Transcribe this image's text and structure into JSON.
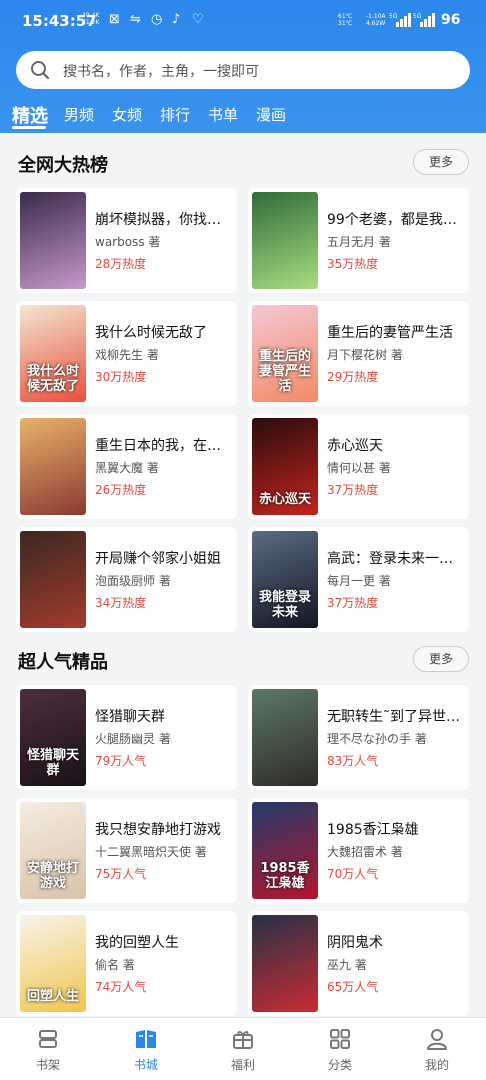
{
  "status_bar": {
    "time": "15:43:57",
    "net_speed_top": "49.4K",
    "net_speed_bottom": "61.2K",
    "temp_top": "61℃",
    "temp_bottom": "31℃",
    "speed_top": "-1.10A",
    "speed_bottom": "4.62W",
    "sim1": "5G",
    "sim2": "5G",
    "battery": "96"
  },
  "search": {
    "placeholder": "搜书名，作者，主角，一搜即可"
  },
  "tabs": [
    {
      "label": "精选",
      "active": true
    },
    {
      "label": "男频"
    },
    {
      "label": "女频"
    },
    {
      "label": "排行"
    },
    {
      "label": "书单"
    },
    {
      "label": "漫画"
    }
  ],
  "sections": [
    {
      "title": "全网大热榜",
      "more": "更多",
      "books": [
        {
          "title": "崩坏模拟器，你找的…",
          "author": "warboss 著",
          "stat": "28万热度",
          "cover_text": "",
          "c1": "#3b2a4a",
          "c2": "#c59ac9"
        },
        {
          "title": "99个老婆，都是我…",
          "author": "五月无月 著",
          "stat": "35万热度",
          "cover_text": "",
          "c1": "#2f6d3a",
          "c2": "#a8dd7f"
        },
        {
          "title": "我什么时候无敌了",
          "author": "戏柳先生 著",
          "stat": "30万热度",
          "cover_text": "我什么时候无敌了",
          "c1": "#f3e6d2",
          "c2": "#e8503b"
        },
        {
          "title": "重生后的妻管严生活",
          "author": "月下樱花树 著",
          "stat": "29万热度",
          "cover_text": "重生后的妻管严生活",
          "c1": "#f4c7d3",
          "c2": "#f28a66"
        },
        {
          "title": "重生日本的我，在灵…",
          "author": "黑翼大魔 著",
          "stat": "26万热度",
          "cover_text": "",
          "c1": "#e9b26a",
          "c2": "#8a3a32"
        },
        {
          "title": "赤心巡天",
          "author": "情何以甚 著",
          "stat": "37万热度",
          "cover_text": "赤心巡天",
          "c1": "#2a0d0d",
          "c2": "#c4241e"
        },
        {
          "title": "开局赚个邻家小姐姐",
          "author": "泡面级厨师 著",
          "stat": "34万热度",
          "cover_text": "",
          "c1": "#3b2822",
          "c2": "#a33b2c"
        },
        {
          "title": "高武：登录未来一万…",
          "author": "每月一更 著",
          "stat": "37万热度",
          "cover_text": "我能登录未来",
          "c1": "#5b6b85",
          "c2": "#131722"
        }
      ]
    },
    {
      "title": "超人气精品",
      "more": "更多",
      "books": [
        {
          "title": "怪猎聊天群",
          "author": "火腿肠幽灵 著",
          "stat": "79万人气",
          "cover_text": "怪猎聊天群",
          "c1": "#4c2f40",
          "c2": "#1c1117"
        },
        {
          "title": "无职转生˜到了异世…",
          "author": "理不尽な孙の手 著",
          "stat": "83万人气",
          "cover_text": "",
          "c1": "#5c7a63",
          "c2": "#2f2a2a"
        },
        {
          "title": "我只想安静地打游戏",
          "author": "十二翼黑暗炽天使 著",
          "stat": "75万人气",
          "cover_text": "安静地打游戏",
          "c1": "#f5ece1",
          "c2": "#d9c3aa"
        },
        {
          "title": "1985香江枭雄",
          "author": "大魏招雷术 著",
          "stat": "70万人气",
          "cover_text": "1985香江枭雄",
          "c1": "#223c6b",
          "c2": "#b5152d"
        },
        {
          "title": "我的回塑人生",
          "author": "偷名 著",
          "stat": "74万人气",
          "cover_text": "回塑人生",
          "c1": "#f7f3ea",
          "c2": "#f0c64f"
        },
        {
          "title": "阴阳鬼术",
          "author": "巫九 著",
          "stat": "65万人气",
          "cover_text": "",
          "c1": "#263146",
          "c2": "#ca2b33"
        }
      ]
    }
  ],
  "bottom_nav": [
    {
      "label": "书架",
      "icon": "bookshelf-icon"
    },
    {
      "label": "书城",
      "icon": "bookstore-icon",
      "active": true
    },
    {
      "label": "福利",
      "icon": "gift-icon"
    },
    {
      "label": "分类",
      "icon": "category-grid-icon"
    },
    {
      "label": "我的",
      "icon": "profile-icon"
    }
  ],
  "colors": {
    "brand": "#2b87ea",
    "heat": "#e5483b"
  }
}
